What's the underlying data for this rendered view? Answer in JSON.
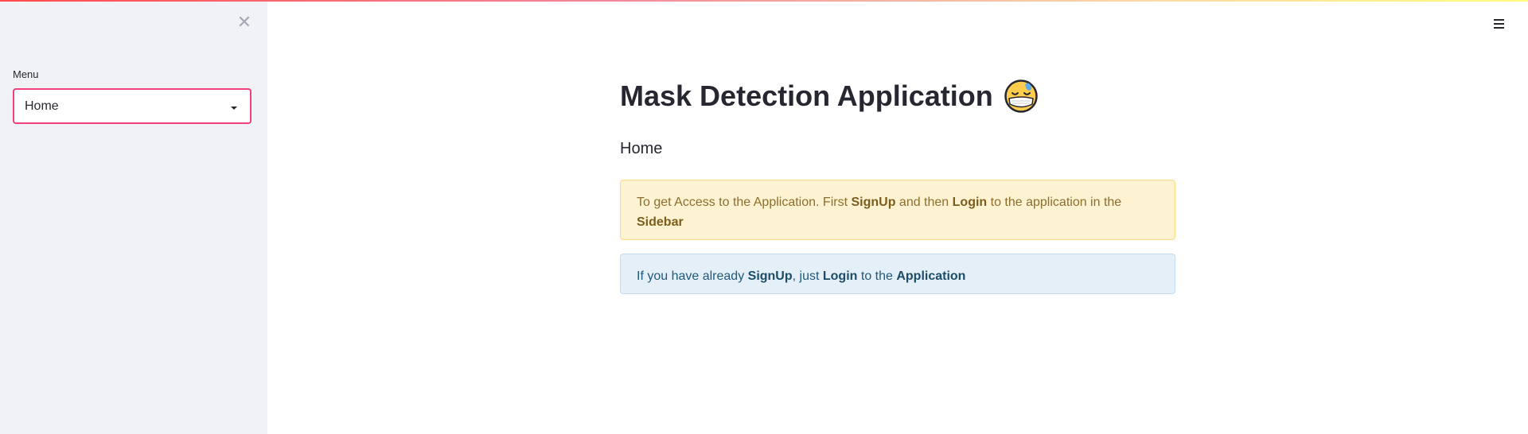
{
  "sidebar": {
    "close_icon": "close-icon",
    "menu_label": "Menu",
    "select": {
      "value": "Home",
      "icon": "chevron-down-icon"
    }
  },
  "header": {
    "menu_icon": "hamburger-menu-icon"
  },
  "main": {
    "title": "Mask Detection Application",
    "title_emoji": "face-with-mask-emoji-icon",
    "subheader": "Home",
    "warning_alert": {
      "t1": "To get Access to the Application. First ",
      "b1": "SignUp",
      "t2": " and then ",
      "b2": "Login",
      "t3": " to the application in the ",
      "b3": "Sidebar"
    },
    "info_alert": {
      "t1": "If you have already ",
      "b1": "SignUp",
      "t2": ", just ",
      "b2": "Login",
      "t3": " to the ",
      "b3": "Application"
    }
  },
  "colors": {
    "accent": "#f1407c",
    "sidebar_bg": "#f0f2f6",
    "warning_bg": "#fdf2d2",
    "info_bg": "#e5eff8"
  }
}
